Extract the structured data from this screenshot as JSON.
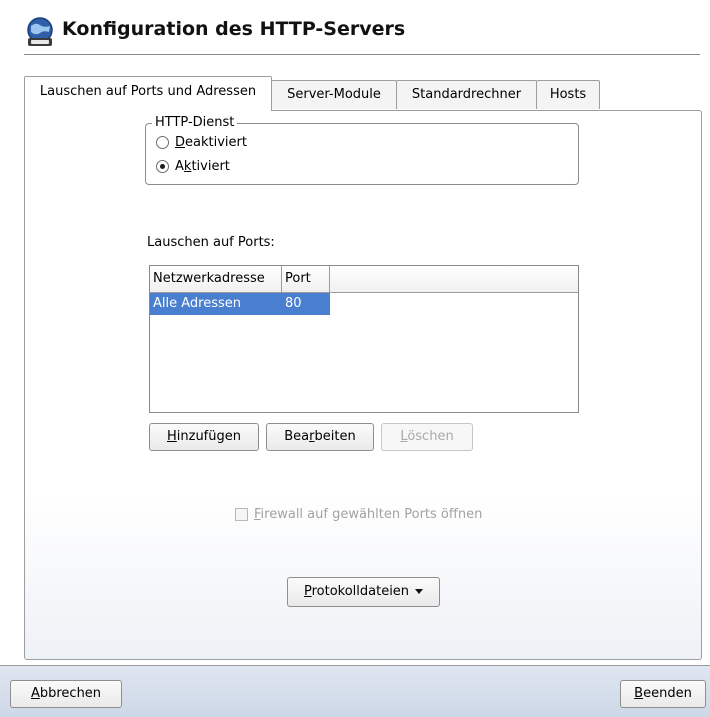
{
  "dialog": {
    "title": "Konfiguration des HTTP-Servers",
    "icon": "globe-icon"
  },
  "tabs": [
    {
      "label": "Lauschen auf Ports und Adressen",
      "active": true
    },
    {
      "label": "Server-Module",
      "active": false
    },
    {
      "label": "Standardrechner",
      "active": false
    },
    {
      "label": "Hosts",
      "active": false
    }
  ],
  "http_service": {
    "group_title": "HTTP-Dienst",
    "options": [
      {
        "label_accel": "D",
        "label_rest": "eaktiviert",
        "checked": false
      },
      {
        "label_pre": "A",
        "label_accel": "k",
        "label_rest": "tiviert",
        "checked": true
      }
    ]
  },
  "ports": {
    "label": "Lauschen auf Ports:",
    "columns": [
      "Netzwerkadresse",
      "Port"
    ],
    "rows": [
      {
        "address": "Alle Adressen",
        "port": "80",
        "selected": true
      }
    ]
  },
  "buttons": {
    "add": {
      "accel": "H",
      "rest": "inzufügen"
    },
    "edit": {
      "pre": "Bea",
      "accel": "r",
      "rest": "beiten"
    },
    "delete": {
      "accel": "L",
      "rest": "öschen",
      "disabled": true
    }
  },
  "firewall": {
    "accel": "F",
    "rest": "irewall auf gewählten Ports öffnen",
    "checked": false,
    "disabled": true
  },
  "logfiles": {
    "accel": "P",
    "rest": "rotokolldateien",
    "icon": "dropdown-arrow-icon"
  },
  "footer": {
    "cancel": {
      "accel": "A",
      "rest": "bbrechen"
    },
    "finish": {
      "accel": "B",
      "rest": "eenden"
    }
  },
  "colors": {
    "selection": "#4a7fd0",
    "footer_bg": "#d6deec"
  }
}
